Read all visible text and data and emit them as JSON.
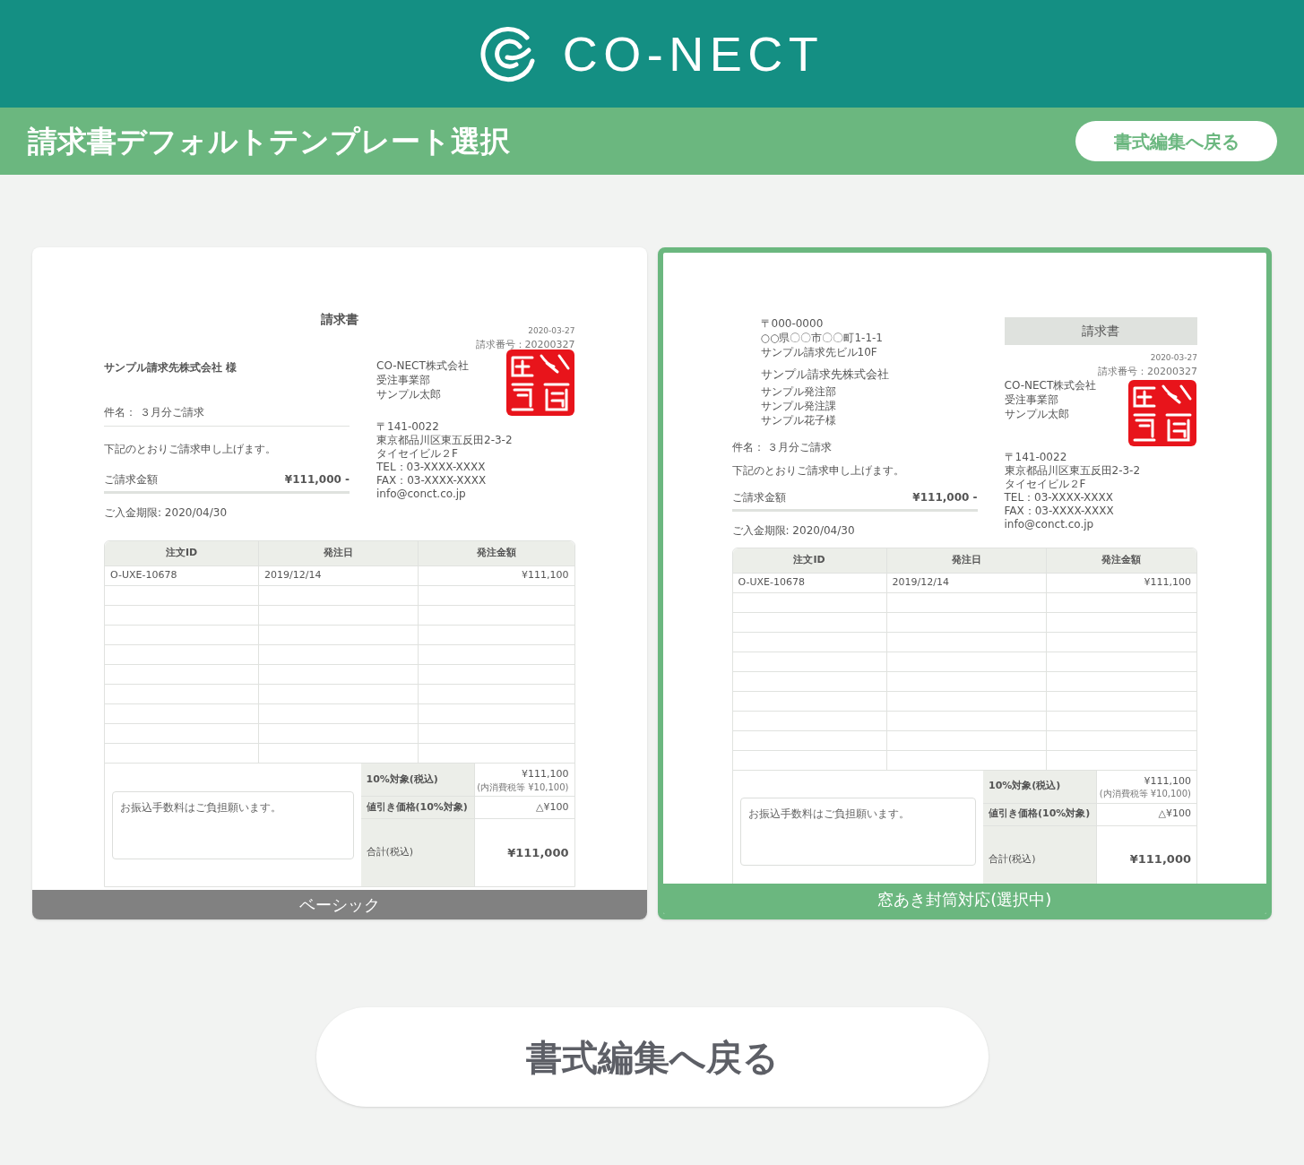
{
  "header": {
    "logo_text": "CO-NECT"
  },
  "title_bar": {
    "title": "請求書デフォルトテンプレート選択",
    "back_button": "書式編集へ戻る"
  },
  "templates": [
    {
      "kind": "basic",
      "label": "ベーシック",
      "selected": false,
      "invoice": {
        "title": "請求書",
        "date": "2020-03-27",
        "number": "請求番号：20200327",
        "recipient_company": "サンプル請求先株式会社 様",
        "subject": "件名： ３月分ご請求",
        "message": "下記のとおりご請求申し上げます。",
        "amount_label": "ご請求金額",
        "amount": "¥111,000 -",
        "due": "ご入金期限: 2020/04/30",
        "issuer": [
          "CO-NECT株式会社",
          "受注事業部",
          "サンプル太郎"
        ],
        "issuer_contact": [
          "〒141-0022",
          "東京都品川区東五反田2-3-2",
          "タイセイビル２F",
          "TEL：03-XXXX-XXXX",
          "FAX：03-XXXX-XXXX",
          "info@conct.co.jp"
        ],
        "columns": [
          "注文ID",
          "発注日",
          "発注金額"
        ],
        "rows": [
          [
            "O-UXE-10678",
            "2019/12/14",
            "¥111,100"
          ]
        ],
        "note": "お振込手数料はご負担願います。",
        "summary": [
          {
            "kind": "subtotal",
            "label": "10%対象(税込)",
            "value": "¥111,100",
            "sub": "(内消費税等 ¥10,100)"
          },
          {
            "kind": "discount",
            "label": "値引き価格(10%対象)",
            "value": "△¥100"
          },
          {
            "kind": "total",
            "label": "合計(税込)",
            "value": "¥111,000"
          }
        ]
      }
    },
    {
      "kind": "window",
      "label": "窓あき封筒対応(選択中)",
      "selected": true,
      "invoice": {
        "title": "請求書",
        "date": "2020-03-27",
        "number": "請求番号：20200327",
        "recipient_address": [
          "〒000-0000",
          "○○県〇〇市〇〇町1-1-1",
          "サンプル請求先ビル10F"
        ],
        "recipient_company": "サンプル請求先株式会社",
        "recipient_lines": [
          "サンプル発注部",
          "サンプル発注課",
          "サンプル花子様"
        ],
        "subject": "件名： ３月分ご請求",
        "message": "下記のとおりご請求申し上げます。",
        "amount_label": "ご請求金額",
        "amount": "¥111,000 -",
        "due": "ご入金期限: 2020/04/30",
        "issuer": [
          "CO-NECT株式会社",
          "受注事業部",
          "サンプル太郎"
        ],
        "issuer_contact": [
          "〒141-0022",
          "東京都品川区東五反田2-3-2",
          "タイセイビル２F",
          "TEL：03-XXXX-XXXX",
          "FAX：03-XXXX-XXXX",
          "info@conct.co.jp"
        ],
        "columns": [
          "注文ID",
          "発注日",
          "発注金額"
        ],
        "rows": [
          [
            "O-UXE-10678",
            "2019/12/14",
            "¥111,100"
          ]
        ],
        "note": "お振込手数料はご負担願います。",
        "summary": [
          {
            "kind": "subtotal",
            "label": "10%対象(税込)",
            "value": "¥111,100",
            "sub": "(内消費税等 ¥10,100)"
          },
          {
            "kind": "discount",
            "label": "値引き価格(10%対象)",
            "value": "△¥100"
          },
          {
            "kind": "total",
            "label": "合計(税込)",
            "value": "¥111,000"
          }
        ]
      }
    }
  ],
  "footer_button": "書式編集へ戻る"
}
